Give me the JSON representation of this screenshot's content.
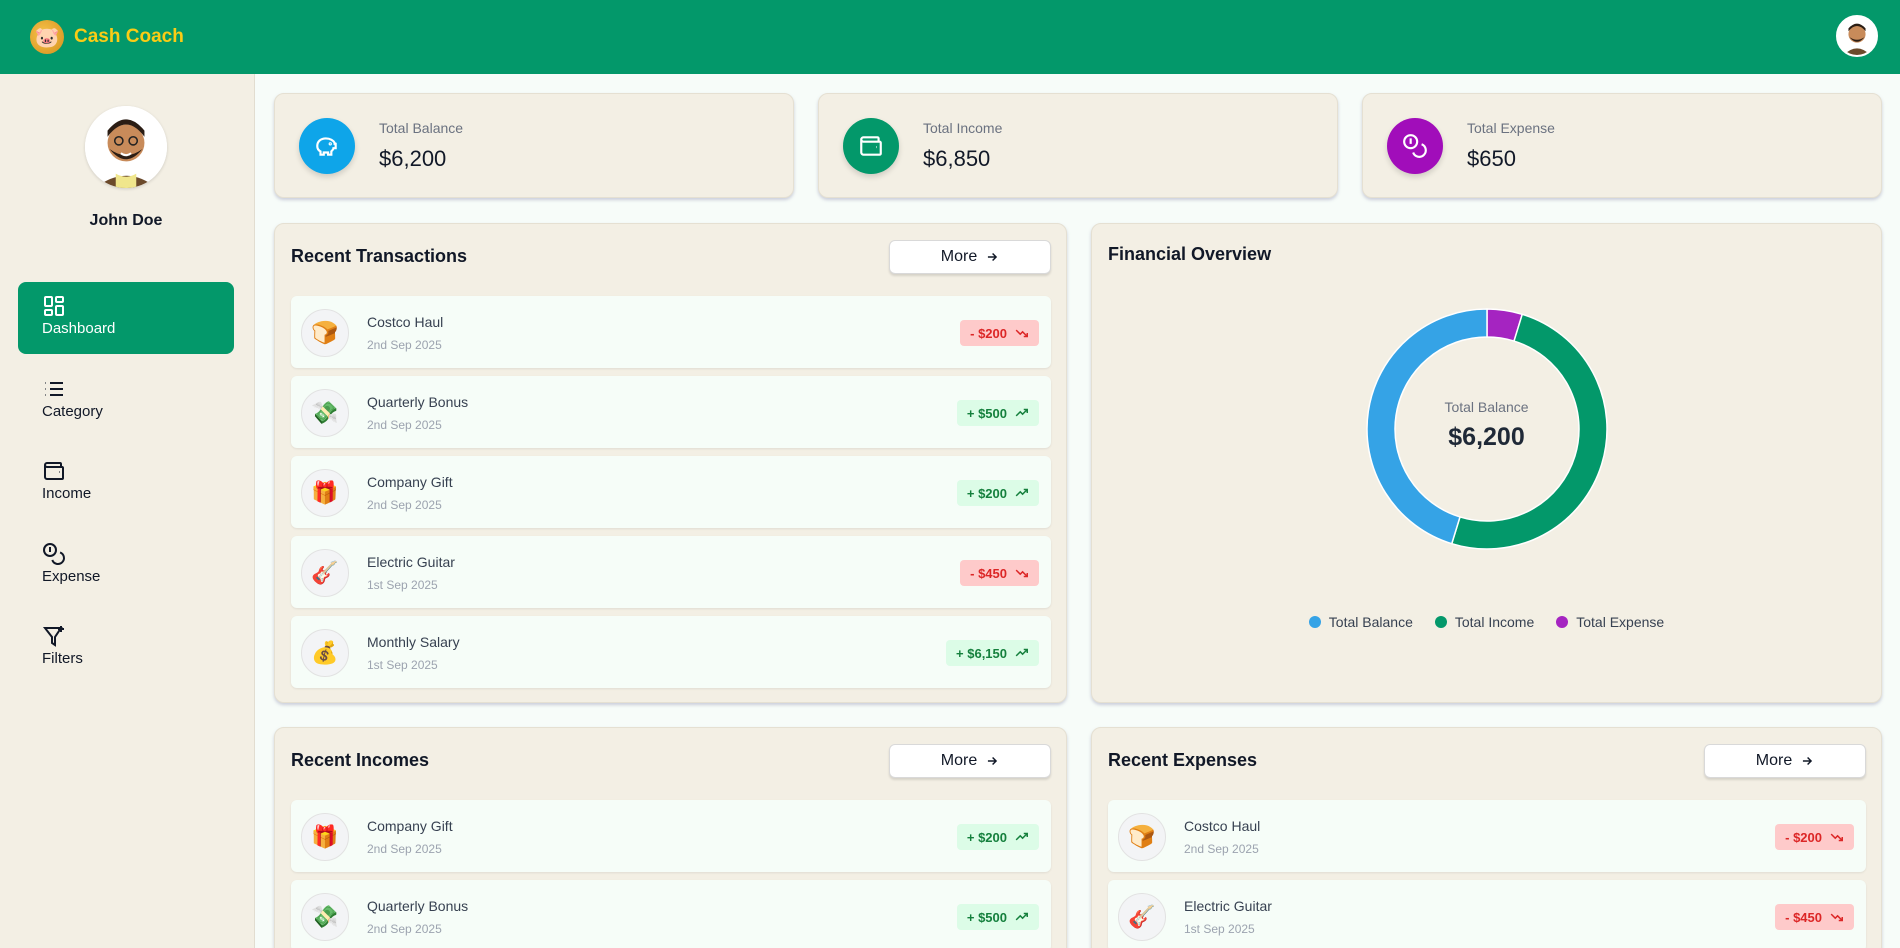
{
  "app": {
    "name": "Cash Coach",
    "logo_icon": "piggy-bank-icon"
  },
  "user": {
    "name": "John Doe"
  },
  "sidebar": {
    "items": [
      {
        "label": "Dashboard",
        "icon": "dashboard-icon",
        "active": true
      },
      {
        "label": "Category",
        "icon": "list-icon",
        "active": false
      },
      {
        "label": "Income",
        "icon": "wallet-icon",
        "active": false
      },
      {
        "label": "Expense",
        "icon": "coins-icon",
        "active": false
      },
      {
        "label": "Filters",
        "icon": "filter-icon",
        "active": false
      }
    ]
  },
  "stats": [
    {
      "label": "Total Balance",
      "value": "$6,200",
      "color": "#0ea5e9",
      "icon": "piggy-bank-icon"
    },
    {
      "label": "Total Income",
      "value": "$6,850",
      "color": "#03986a",
      "icon": "wallet-icon"
    },
    {
      "label": "Total Expense",
      "value": "$650",
      "color": "#a10dba",
      "icon": "coins-icon"
    }
  ],
  "recent_transactions": {
    "title": "Recent Transactions",
    "more_label": "More",
    "items": [
      {
        "name": "Costco Haul",
        "date": "2nd Sep 2025",
        "amount": "- $200",
        "type": "expense",
        "icon": "🍞"
      },
      {
        "name": "Quarterly Bonus",
        "date": "2nd Sep 2025",
        "amount": "+ $500",
        "type": "income",
        "icon": "💸"
      },
      {
        "name": "Company Gift",
        "date": "2nd Sep 2025",
        "amount": "+ $200",
        "type": "income",
        "icon": "🎁"
      },
      {
        "name": "Electric Guitar",
        "date": "1st Sep 2025",
        "amount": "- $450",
        "type": "expense",
        "icon": "🎸"
      },
      {
        "name": "Monthly Salary",
        "date": "1st Sep 2025",
        "amount": "+ $6,150",
        "type": "income",
        "icon": "💰"
      }
    ]
  },
  "financial_overview": {
    "title": "Financial Overview",
    "center_label": "Total Balance",
    "center_value": "$6,200"
  },
  "chart_data": {
    "type": "pie",
    "categories": [
      "Total Balance",
      "Total Income",
      "Total Expense"
    ],
    "values": [
      6200,
      6850,
      650
    ],
    "colors": [
      "#35a3e6",
      "#03986a",
      "#a524c1"
    ],
    "legend": "bottom"
  },
  "recent_incomes": {
    "title": "Recent Incomes",
    "more_label": "More",
    "items": [
      {
        "name": "Company Gift",
        "date": "2nd Sep 2025",
        "amount": "+ $200",
        "type": "income",
        "icon": "🎁"
      },
      {
        "name": "Quarterly Bonus",
        "date": "2nd Sep 2025",
        "amount": "+ $500",
        "type": "income",
        "icon": "💸"
      }
    ]
  },
  "recent_expenses": {
    "title": "Recent Expenses",
    "more_label": "More",
    "items": [
      {
        "name": "Costco Haul",
        "date": "2nd Sep 2025",
        "amount": "- $200",
        "type": "expense",
        "icon": "🍞"
      },
      {
        "name": "Electric Guitar",
        "date": "1st Sep 2025",
        "amount": "- $450",
        "type": "expense",
        "icon": "🎸"
      }
    ]
  }
}
